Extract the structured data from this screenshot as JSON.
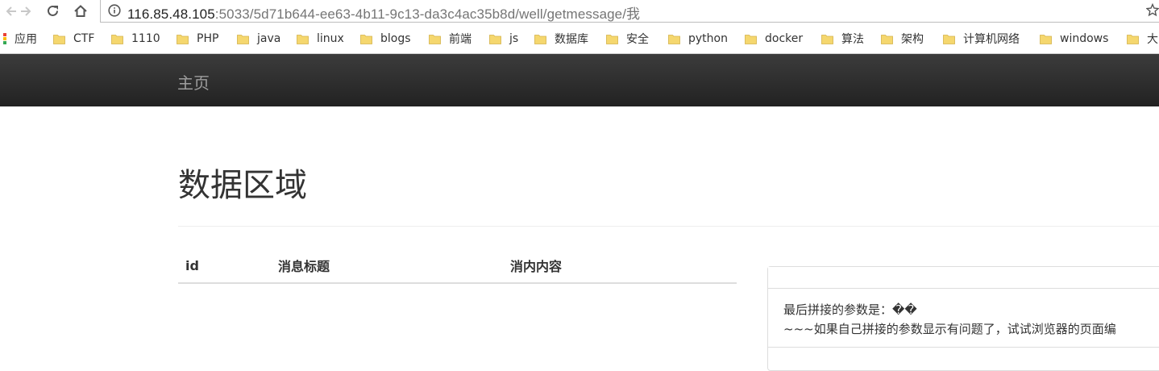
{
  "browser": {
    "url_host": "116.85.48.105",
    "url_path": ":5033/5d71b644-ee63-4b11-9c13-da3c4ac35b8d/well/getmessage/我",
    "nav": [
      "back-icon",
      "forward-icon",
      "reload-icon",
      "home-icon"
    ],
    "bookmarks": [
      {
        "label": "应用",
        "icon": "apps-icon"
      },
      {
        "label": "CTF",
        "icon": "folder-icon"
      },
      {
        "label": "1110",
        "icon": "folder-icon"
      },
      {
        "label": "PHP",
        "icon": "folder-icon"
      },
      {
        "label": "java",
        "icon": "folder-icon"
      },
      {
        "label": "linux",
        "icon": "folder-icon"
      },
      {
        "label": "blogs",
        "icon": "folder-icon"
      },
      {
        "label": "前端",
        "icon": "folder-icon"
      },
      {
        "label": "js",
        "icon": "folder-icon"
      },
      {
        "label": "数据库",
        "icon": "folder-icon"
      },
      {
        "label": "安全",
        "icon": "folder-icon"
      },
      {
        "label": "python",
        "icon": "folder-icon"
      },
      {
        "label": "docker",
        "icon": "folder-icon"
      },
      {
        "label": "算法",
        "icon": "folder-icon"
      },
      {
        "label": "架构",
        "icon": "folder-icon"
      },
      {
        "label": "计算机网络",
        "icon": "folder-icon"
      },
      {
        "label": "windows",
        "icon": "folder-icon"
      },
      {
        "label": "大",
        "icon": "folder-icon"
      }
    ]
  },
  "navbar": {
    "brand": "主页"
  },
  "main": {
    "title": "数据区域",
    "table": {
      "headers": [
        "id",
        "消息标题",
        "消内内容"
      ]
    }
  },
  "panel": {
    "line1": "最后拼接的参数是：��",
    "line2": "~~~如果自己拼接的参数显示有问题了，试试浏览器的页面编"
  },
  "colors": {
    "navbar_bg": "#222222",
    "brand_text": "#9d9d9d",
    "folder": "#f5d76e"
  }
}
